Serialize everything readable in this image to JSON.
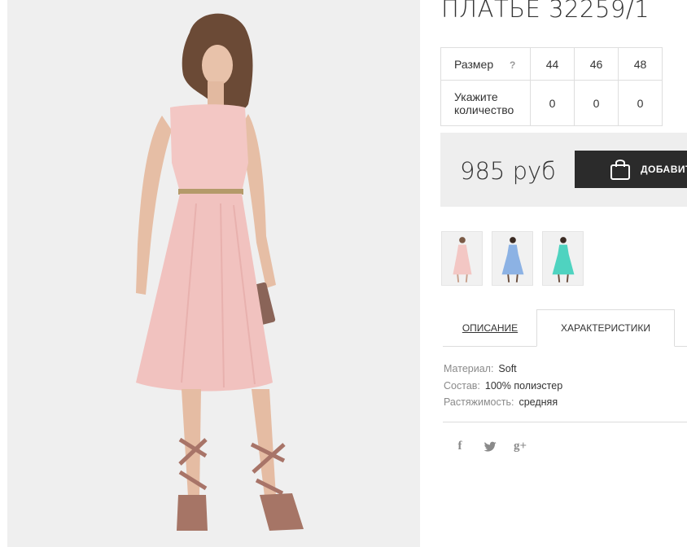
{
  "product": {
    "title": "ПЛАТЬЕ 32259/1"
  },
  "size_table": {
    "size_label": "Размер",
    "help_icon": "?",
    "sizes": [
      "44",
      "46",
      "48"
    ],
    "qty_label_line1": "Укажите",
    "qty_label_line2": "количество",
    "quantities": [
      "0",
      "0",
      "0"
    ]
  },
  "purchase": {
    "price": "985 руб",
    "add_label": "ДОБАВИТЬ",
    "bag_icon": "shopping-bag-icon"
  },
  "thumbnails": [
    {
      "color": "pink",
      "dress_hex": "#f3c7c4"
    },
    {
      "color": "blue",
      "dress_hex": "#8cb2e4"
    },
    {
      "color": "turquoise",
      "dress_hex": "#4fd3c0"
    }
  ],
  "tabs": {
    "description": "ОПИСАНИЕ",
    "characteristics": "ХАРАКТЕРИСТИКИ",
    "active": "characteristics"
  },
  "specs": [
    {
      "key": "Материал:",
      "value": "Soft"
    },
    {
      "key": "Состав:",
      "value": "100% полиэстер"
    },
    {
      "key": "Растяжимость:",
      "value": "средняя"
    }
  ],
  "social": {
    "facebook": "f",
    "twitter_icon": "twitter-bird-icon",
    "google_plus": "g+"
  },
  "colors": {
    "dress_pink": "#f3c7c4",
    "button_dark": "#2b2b2b",
    "price_box_bg": "#eeeeee"
  }
}
